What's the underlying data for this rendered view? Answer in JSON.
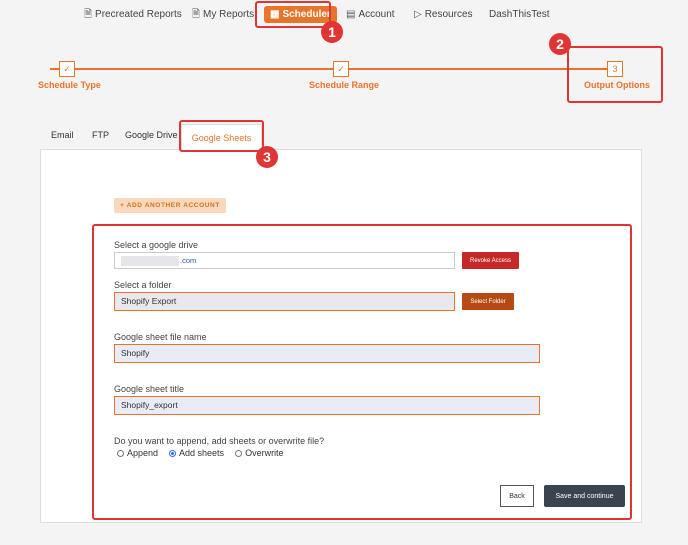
{
  "nav": {
    "items": [
      {
        "label": "Precreated Reports",
        "icon": "document-icon"
      },
      {
        "label": "My Reports",
        "icon": "report-icon"
      },
      {
        "label": "Scheduler",
        "icon": "calendar-icon"
      },
      {
        "label": "Account",
        "icon": "account-card-icon"
      },
      {
        "label": "Resources",
        "icon": "play-icon"
      },
      {
        "label": "DashThisTest",
        "icon": ""
      }
    ],
    "active": "Scheduler"
  },
  "callouts": [
    "1",
    "2",
    "3"
  ],
  "stepper": {
    "steps": [
      {
        "label": "Schedule Type",
        "mark": "✓"
      },
      {
        "label": "Schedule Range",
        "mark": "✓"
      },
      {
        "label": "Output Options",
        "mark": "3"
      }
    ]
  },
  "tabs": {
    "items": [
      "Email",
      "FTP",
      "Google Drive",
      "Google Sheets"
    ],
    "active": "Google Sheets"
  },
  "form": {
    "add_account_label": "+ ADD ANOTHER ACCOUNT",
    "drive_label": "Select a google drive",
    "drive_value_suffix": ".com",
    "revoke_label": "Revoke Access",
    "folder_label": "Select a folder",
    "folder_value": "Shopify Export",
    "select_folder_label": "Select Folder",
    "file_name_label": "Google sheet file name",
    "file_name_value": "Shopify",
    "sheet_title_label": "Google sheet title",
    "sheet_title_value": "Shopify_export",
    "mode_question": "Do you want to append, add sheets or overwrite file?",
    "mode_options": [
      "Append",
      "Add sheets",
      "Overwrite"
    ],
    "mode_selected": "Add sheets",
    "back_label": "Back",
    "save_label": "Save and continue"
  },
  "colors": {
    "accent": "#e8742c",
    "annotation": "#e03535",
    "revoke": "#c62828",
    "select_folder": "#b54a12",
    "save_button": "#3c4350"
  }
}
